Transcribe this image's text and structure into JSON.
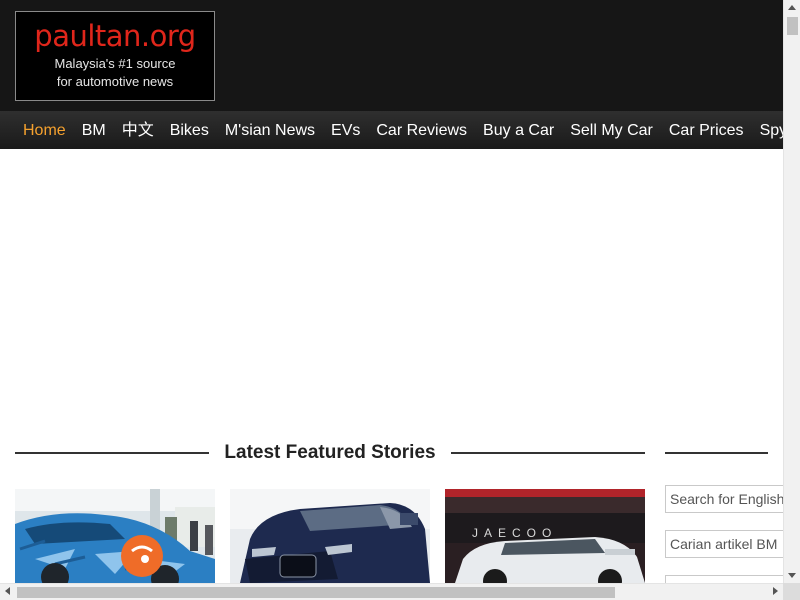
{
  "logo": {
    "name": "paultan.org",
    "tagline_1": "Malaysia's #1 source",
    "tagline_2": "for automotive news",
    "brand_color": "#e0261b"
  },
  "nav": {
    "active_color": "#f5a12e",
    "items": [
      {
        "label": "Home",
        "active": true
      },
      {
        "label": "BM"
      },
      {
        "label": "中文"
      },
      {
        "label": "Bikes"
      },
      {
        "label": "M'sian News"
      },
      {
        "label": "EVs"
      },
      {
        "label": "Car Reviews"
      },
      {
        "label": "Buy a Car"
      },
      {
        "label": "Sell My Car"
      },
      {
        "label": "Car Prices"
      },
      {
        "label": "Spy"
      }
    ]
  },
  "featured": {
    "title": "Latest Featured Stories",
    "cards": [
      {
        "image": "blue-camouflaged-suv-photo"
      },
      {
        "image": "dark-blue-jaguar-suv-photo"
      },
      {
        "image": "jaecoo-white-suv-launch-photo",
        "sign_text": "JAECOO"
      }
    ]
  },
  "sidebar": {
    "search_english_placeholder": "Search for English s",
    "search_bm_placeholder": "Carian artikel BM"
  }
}
